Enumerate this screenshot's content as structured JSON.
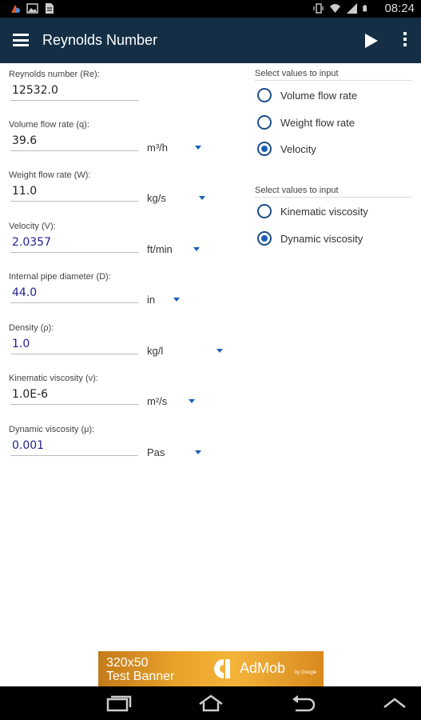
{
  "status_bar": {
    "time": "08:24",
    "icons": [
      "notification-icon",
      "image-icon",
      "document-icon",
      "vibrate-icon",
      "wifi-icon",
      "signal-icon",
      "battery-icon"
    ]
  },
  "action_bar": {
    "title": "Reynolds Number",
    "background": "#142f45",
    "icons": [
      "menu-icon",
      "run-icon",
      "overflow-icon"
    ]
  },
  "form": {
    "fields": [
      {
        "label": "Reynolds number (Re):",
        "value": "12532.0",
        "unit": ""
      },
      {
        "label": "Volume flow rate (q):",
        "value": "39.6",
        "unit": "m³/h"
      },
      {
        "label": "Weight flow rate (W):",
        "value": "11.0",
        "unit": "kg/s"
      },
      {
        "label": "Velocity (V):",
        "value": "2.0357",
        "unit": "ft/min"
      },
      {
        "label": "Internal pipe diameter (D):",
        "value": "44.0",
        "unit": "in"
      },
      {
        "label": "Density (ρ):",
        "value": "1.0",
        "unit": "kg/l"
      },
      {
        "label": "Kinematic viscosity (ν):",
        "value": "1.0E-6",
        "unit": "m²/s"
      },
      {
        "label": "Dynamic viscosity (μ):",
        "value": "0.001",
        "unit": "Pas"
      }
    ]
  },
  "radio_groups": [
    {
      "title": "Select values to input",
      "options": [
        {
          "label": "Volume flow rate",
          "checked": false
        },
        {
          "label": "Weight flow rate",
          "checked": false
        },
        {
          "label": "Velocity",
          "checked": true
        }
      ]
    },
    {
      "title": "Select values to input",
      "options": [
        {
          "label": "Kinematic viscosity",
          "checked": false
        },
        {
          "label": "Dynamic viscosity",
          "checked": true
        }
      ]
    }
  ],
  "ad": {
    "size_text": "320x50",
    "banner_text": "Test Banner",
    "brand": "AdMob",
    "brand_sub": "by Google"
  },
  "nav_bar": {
    "icons": [
      "recent-apps-icon",
      "home-icon",
      "back-icon",
      "collapse-icon"
    ]
  },
  "colors": {
    "accent": "#1a5fb4",
    "action_bar": "#142f45",
    "active_value": "#23238f"
  }
}
